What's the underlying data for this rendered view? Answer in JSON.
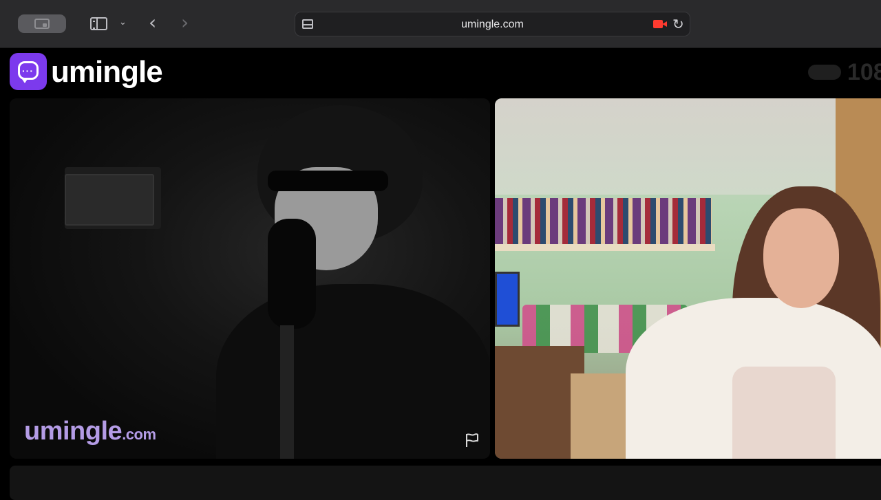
{
  "browser": {
    "url": "umingle.com",
    "icons": [
      "tab-overview-icon",
      "sidebar-icon",
      "chevron-down-icon",
      "back-icon",
      "forward-icon",
      "reader-icon",
      "camera-recording-icon",
      "reload-icon"
    ],
    "glyphs": {
      "chevron": "⌄",
      "back": "‹",
      "forward": "›",
      "reload": "↻"
    }
  },
  "site": {
    "brand": "umingle",
    "online_count": "108",
    "watermark": {
      "name": "umingle",
      "tld": ".com"
    },
    "accent_color": "#7c3aed"
  }
}
